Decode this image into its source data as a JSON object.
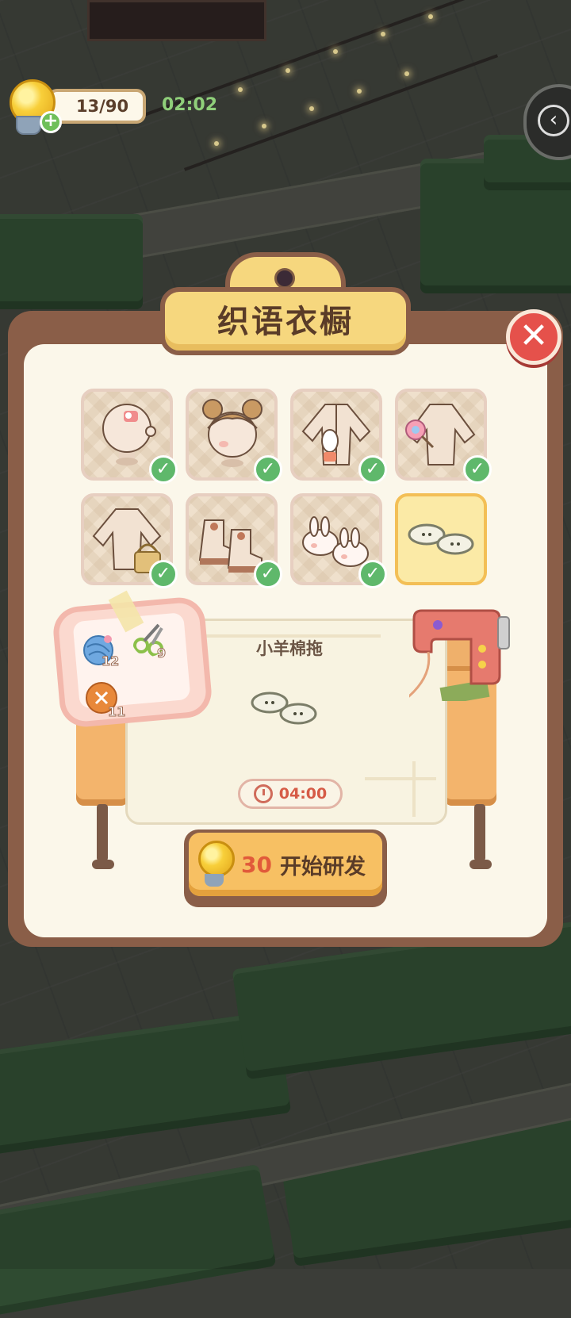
{
  "hud": {
    "bulbs": "13/90",
    "add_symbol": "+",
    "timer": "02:02",
    "side_arrow": "‹"
  },
  "dialog": {
    "title": "织语衣橱",
    "close_symbol": "✕"
  },
  "wardrobe": {
    "items": [
      {
        "name": "bunny-hairclip",
        "unlocked": true
      },
      {
        "name": "bun-hairstyle",
        "unlocked": true
      },
      {
        "name": "bunny-cardigan",
        "unlocked": true
      },
      {
        "name": "lollipop-top",
        "unlocked": true
      },
      {
        "name": "basket-top",
        "unlocked": true
      },
      {
        "name": "bow-boots",
        "unlocked": true
      },
      {
        "name": "bunny-slippers",
        "unlocked": true
      },
      {
        "name": "sheep-slippers",
        "unlocked": false,
        "selected": true
      }
    ],
    "check_symbol": "✓"
  },
  "materials": [
    {
      "name": "yarn-ball",
      "count": "12"
    },
    {
      "name": "scissors",
      "count": "9"
    },
    {
      "name": "button",
      "count": "11"
    }
  ],
  "research": {
    "item_name": "小羊棉拖",
    "duration": "04:00",
    "cost": "30",
    "button_label": "开始研发"
  },
  "colors": {
    "panel_frame": "#8a5e48",
    "panel_fill": "#fbf7ea",
    "title_tag": "#f6d77e",
    "close_red": "#e5514b",
    "check_green": "#5fb86b",
    "cost_red": "#e15a3a",
    "timer_green": "#8fcf7a"
  }
}
